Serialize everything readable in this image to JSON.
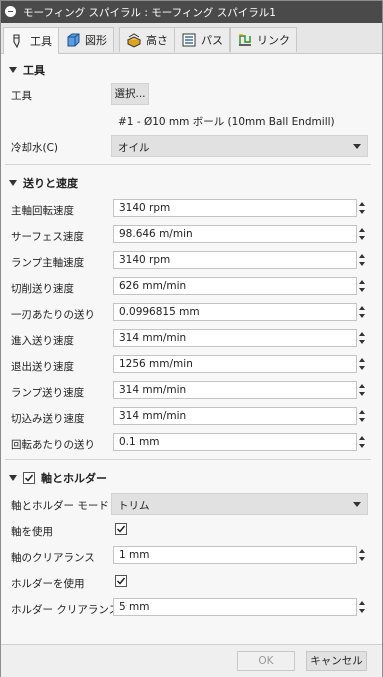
{
  "window": {
    "title": "モーフィング スパイラル : モーフィング スパイラル1"
  },
  "tabs": [
    {
      "label": "工具",
      "icon": "tool-icon",
      "active": true
    },
    {
      "label": "図形",
      "icon": "geometry-icon"
    },
    {
      "label": "高さ",
      "icon": "heights-icon"
    },
    {
      "label": "パス",
      "icon": "passes-icon"
    },
    {
      "label": "リンク",
      "icon": "linking-icon"
    }
  ],
  "tool_section": {
    "heading": "工具",
    "tool_label": "工具",
    "select_button": "選択...",
    "tool_description": "#1 - Ø10 mm ボール (10mm Ball Endmill)",
    "coolant_label": "冷却水(C)",
    "coolant_value": "オイル"
  },
  "feed_section": {
    "heading": "送りと速度",
    "fields": [
      {
        "label": "主軸回転速度",
        "value": "3140 rpm"
      },
      {
        "label": "サーフェス速度",
        "value": "98.646 m/min"
      },
      {
        "label": "ランプ主軸速度",
        "value": "3140 rpm"
      },
      {
        "label": "切削送り速度",
        "value": "626 mm/min"
      },
      {
        "label": "一刃あたりの送り",
        "value": "0.0996815 mm"
      },
      {
        "label": "進入送り速度",
        "value": "314 mm/min"
      },
      {
        "label": "退出送り速度",
        "value": "1256 mm/min"
      },
      {
        "label": "ランプ送り速度",
        "value": "314 mm/min"
      },
      {
        "label": "切込み送り速度",
        "value": "314 mm/min"
      },
      {
        "label": "回転あたりの送り",
        "value": "0.1 mm"
      }
    ]
  },
  "holder_section": {
    "heading": "軸とホルダー",
    "enabled": true,
    "mode_label": "軸とホルダー モード",
    "mode_value": "トリム",
    "use_shaft_label": "軸を使用",
    "use_shaft": true,
    "shaft_clearance_label": "軸のクリアランス",
    "shaft_clearance_value": "1 mm",
    "use_holder_label": "ホルダーを使用",
    "use_holder": true,
    "holder_clearance_label": "ホルダー クリアランス",
    "holder_clearance_value": "5 mm"
  },
  "footer": {
    "ok_label": "OK",
    "cancel_label": "キャンセル"
  },
  "colors": {
    "titlebar": "#4a4a4a",
    "panel": "#f7f7f7",
    "field_border": "#c4c4c4",
    "dropdown": "#e1e1e1"
  }
}
